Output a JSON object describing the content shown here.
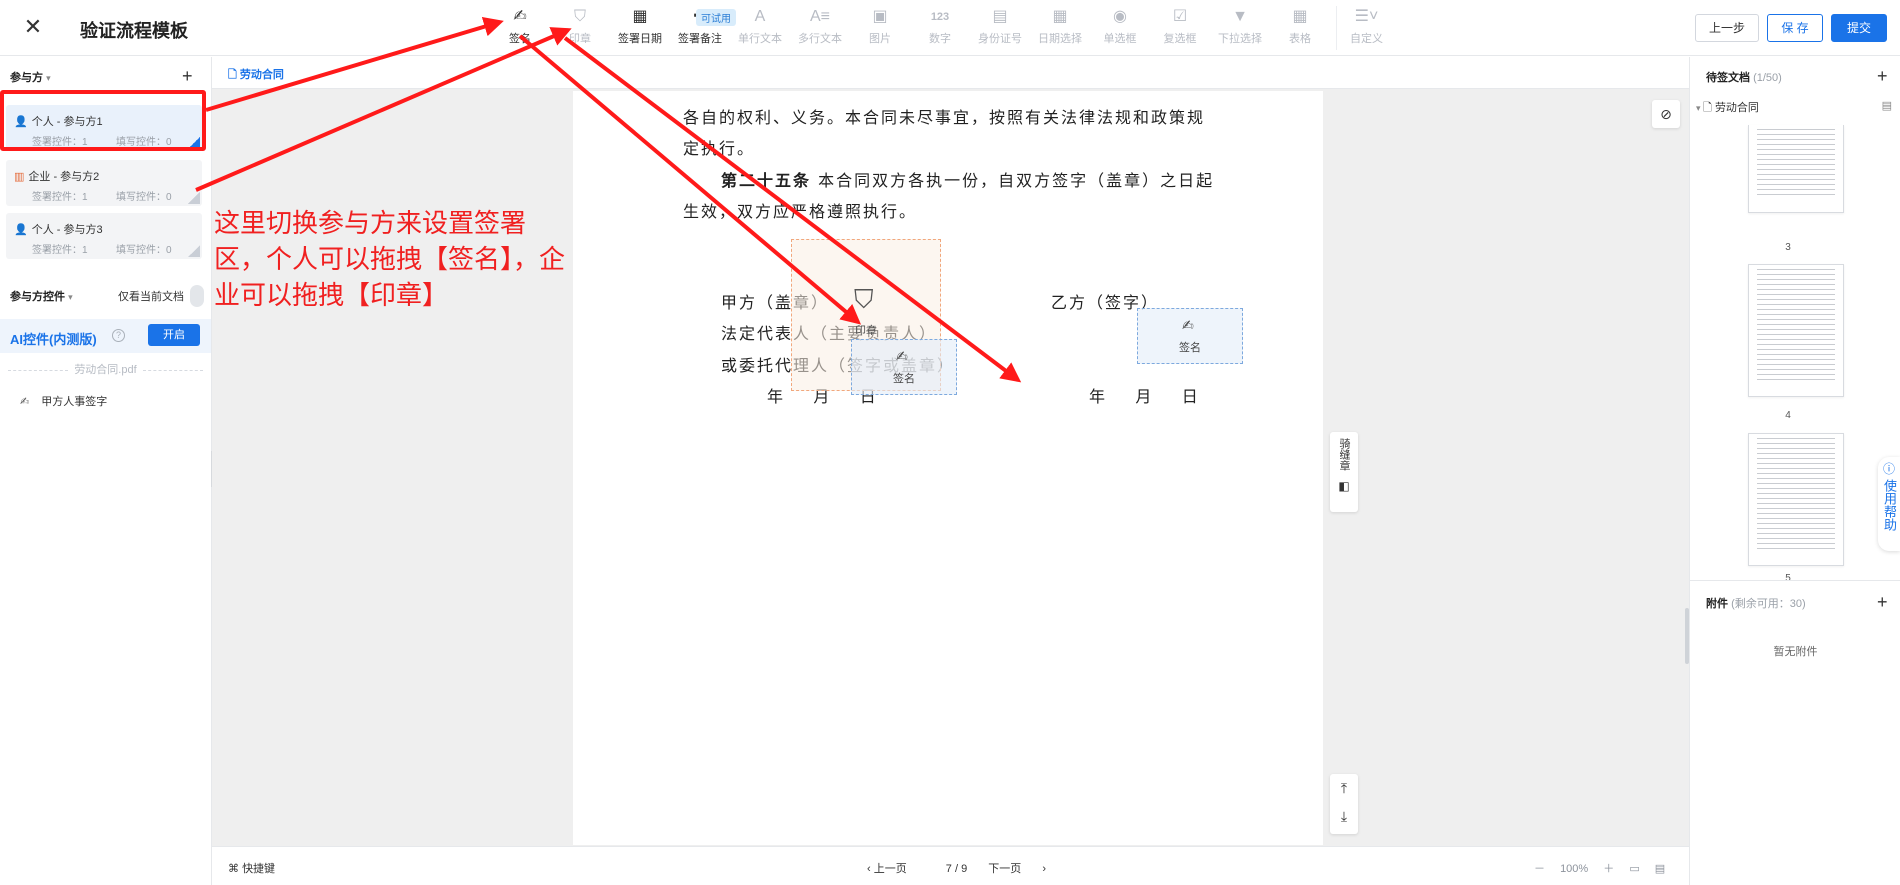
{
  "header": {
    "close_glyph": "✕",
    "title": "验证流程模板",
    "try_badge": "可试用",
    "tools": [
      {
        "label": "签名",
        "icon": "pen-icon",
        "glyph": "✍",
        "disabled": false
      },
      {
        "label": "印章",
        "icon": "stamp-icon",
        "glyph": "⛉",
        "disabled": true
      },
      {
        "label": "签署日期",
        "icon": "calendar-icon",
        "glyph": "▦",
        "disabled": false
      },
      {
        "label": "签署备注",
        "icon": "note-icon",
        "glyph": "✚",
        "disabled": false
      },
      {
        "label": "单行文本",
        "icon": "text-icon",
        "glyph": "A",
        "disabled": true
      },
      {
        "label": "多行文本",
        "icon": "multiline-text-icon",
        "glyph": "A≡",
        "disabled": true
      },
      {
        "label": "图片",
        "icon": "image-icon",
        "glyph": "▣",
        "disabled": true
      },
      {
        "label": "数字",
        "icon": "number-icon",
        "glyph": "123",
        "disabled": true
      },
      {
        "label": "身份证号",
        "icon": "id-card-icon",
        "glyph": "▤",
        "disabled": true
      },
      {
        "label": "日期选择",
        "icon": "date-picker-icon",
        "glyph": "▦",
        "disabled": true
      },
      {
        "label": "单选框",
        "icon": "radio-icon",
        "glyph": "◉",
        "disabled": true
      },
      {
        "label": "复选框",
        "icon": "checkbox-icon",
        "glyph": "☑",
        "disabled": true
      },
      {
        "label": "下拉选择",
        "icon": "dropdown-icon",
        "glyph": "▼",
        "disabled": true
      },
      {
        "label": "表格",
        "icon": "table-icon",
        "glyph": "▦",
        "disabled": true
      },
      {
        "label": "自定义",
        "icon": "custom-icon",
        "glyph": "☰˅",
        "disabled": true
      }
    ],
    "btn_prev": "上一步",
    "btn_save": "保 存",
    "btn_submit": "提交"
  },
  "left": {
    "parties_title": "参与方",
    "parties": [
      {
        "name": "个人 - 参与方1",
        "type": "person",
        "sign_count": "签署控件：1",
        "fill_count": "填写控件：0",
        "active": true
      },
      {
        "name": "企业 - 参与方2",
        "type": "enterprise",
        "sign_count": "签署控件：1",
        "fill_count": "填写控件：0",
        "active": false
      },
      {
        "name": "个人 - 参与方3",
        "type": "person",
        "sign_count": "签署控件：1",
        "fill_count": "填写控件：0",
        "active": false
      }
    ],
    "controls_title": "参与方控件",
    "only_current": "仅看当前文档",
    "ai_title": "AI控件(内测版)",
    "ai_btn": "开启",
    "pdf_name": "劳动合同.pdf",
    "control_item": "甲方人事签字"
  },
  "center": {
    "tab_doc": "劳动合同",
    "page_lines": [
      "各自的权利、义务。本合同未尽事宜，按照有关法律法规和政策规",
      "定执行。"
    ],
    "clause_head": "第二十五条",
    "clause_line1": "本合同双方各执一份，自双方签字（盖章）之日起",
    "clause_line2": "生效，双方应严格遵照执行。",
    "party_a": "甲方（盖章）",
    "legal_rep": "法定代表人（主要负责人）",
    "agent": "或委托代理人（签字或盖章）",
    "date_a": "年    月    日",
    "party_b": "乙方（签字）",
    "date_b": "年    月    日",
    "seal_label": "印章",
    "sign_label": "签名",
    "side_tool": "骑缝章",
    "shortcuts": "快捷键",
    "prev_page": "上一页",
    "page_indicator": "7 / 9",
    "next_page": "下一页",
    "zoom_minus": "－",
    "zoom": "100%",
    "zoom_plus": "＋"
  },
  "right": {
    "pending_title": "待签文档",
    "pending_count": "(1/50)",
    "doc_name": "劳动合同",
    "thumbs": [
      "3",
      "4",
      "5"
    ],
    "attach_title": "附件",
    "attach_remaining": "(剩余可用：30)",
    "attach_empty": "暂无附件",
    "help": "使用帮助"
  },
  "annotation": {
    "text": "这里切换参与方来设置签署区，个人可以拖拽【签名】，企业可以拖拽【印章】",
    "color": "#f02020"
  },
  "colors": {
    "accent": "#1a73e8",
    "annotation_red": "#ff1a1a"
  }
}
